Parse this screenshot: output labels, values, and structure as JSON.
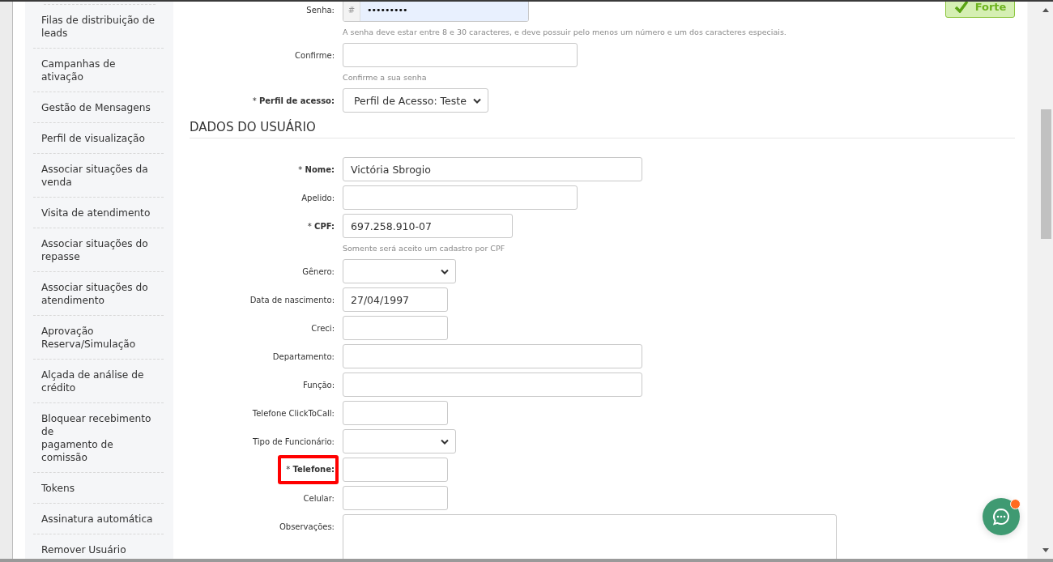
{
  "sidebar": {
    "items": [
      {
        "label": "Filas de distribuição de\nleads"
      },
      {
        "label": "Campanhas de\nativação"
      },
      {
        "label": "Gestão de Mensagens"
      },
      {
        "label": "Perfil de visualização"
      },
      {
        "label": "Associar situações da\nvenda"
      },
      {
        "label": "Visita de atendimento"
      },
      {
        "label": "Associar situações do\nrepasse"
      },
      {
        "label": "Associar situações do\natendimento"
      },
      {
        "label": "Aprovação\nReserva/Simulação"
      },
      {
        "label": "Alçada de análise de\ncrédito"
      },
      {
        "label": "Bloquear recebimento\nde\npagamento de\ncomissão"
      },
      {
        "label": "Tokens"
      },
      {
        "label": "Assinatura automática"
      },
      {
        "label": "Remover Usuário"
      }
    ]
  },
  "password_strength": {
    "label": "Forte"
  },
  "access_fields": [
    {
      "label": "Senha:",
      "kind": "password",
      "prefix": "#",
      "value": "•••••••••",
      "hint": "A senha deve estar entre 8 e 30 caracteres, e deve possuir pelo menos um número e um dos caracteres especiais."
    },
    {
      "label": "Confirme:",
      "kind": "text_long",
      "hint": "Confirme a sua senha"
    },
    {
      "label": "* **Perfil de acesso:**",
      "kind": "select_medium",
      "value": "Perfil de Acesso: Teste"
    }
  ],
  "section_title": "DADOS DO USUÁRIO",
  "user_fields": [
    {
      "label": "* **Nome:**",
      "kind": "text_wide",
      "value": "Victória Sbrogio"
    },
    {
      "label": "Apelido:",
      "kind": "text_long"
    },
    {
      "label": "* **CPF:**",
      "kind": "text_medium",
      "value": "697.258.910-07",
      "hint": "Somente será aceito um cadastro por CPF"
    },
    {
      "label": "Gênero:",
      "kind": "select_short"
    },
    {
      "label": "Data de nascimento:",
      "kind": "text_short",
      "value": "27/04/1997"
    },
    {
      "label": "Creci:",
      "kind": "text_short"
    },
    {
      "label": "Departamento:",
      "kind": "text_wide"
    },
    {
      "label": "Função:",
      "kind": "text_wide"
    },
    {
      "label": "Telefone ClickToCall:",
      "kind": "text_short"
    },
    {
      "label": "Tipo de Funcionário:",
      "kind": "select_short"
    },
    {
      "label": "* **Telefone:**",
      "kind": "text_short",
      "highlighted": true
    },
    {
      "label": "Celular:",
      "kind": "text_short"
    },
    {
      "label": "Observações:",
      "kind": "textarea"
    }
  ]
}
